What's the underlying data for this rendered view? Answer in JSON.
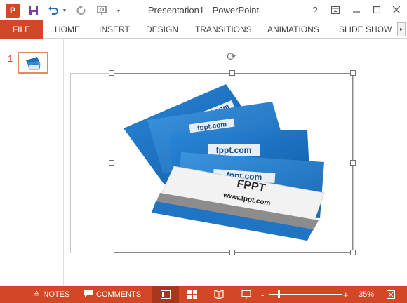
{
  "window": {
    "title": "Presentation1 - PowerPoint",
    "app_icon_letter": "P",
    "help_label": "?",
    "accent_color": "#d24726"
  },
  "quick_access": {
    "icons": [
      "save-icon",
      "undo-icon",
      "redo-icon",
      "start-from-beginning-icon",
      "customize-qat-icon"
    ]
  },
  "ribbon": {
    "file_tab": "FILE",
    "tabs": [
      "HOME",
      "INSERT",
      "DESIGN",
      "TRANSITIONS",
      "ANIMATIONS",
      "SLIDE SHOW"
    ],
    "scroll_right_glyph": "▸"
  },
  "thumbnails": {
    "items": [
      {
        "number": "1",
        "selected": true
      }
    ]
  },
  "slide": {
    "picture": {
      "cards_text": [
        "fppt.com",
        "fppt.com",
        "fppt.com",
        "fppt.com"
      ],
      "front_card_title": "FPPT",
      "front_card_url": "www.fppt.com"
    }
  },
  "statusbar": {
    "notes_label": "NOTES",
    "comments_label": "COMMENTS",
    "zoom_minus": "-",
    "zoom_plus": "+",
    "zoom_level": "35%",
    "active_view": "normal"
  }
}
